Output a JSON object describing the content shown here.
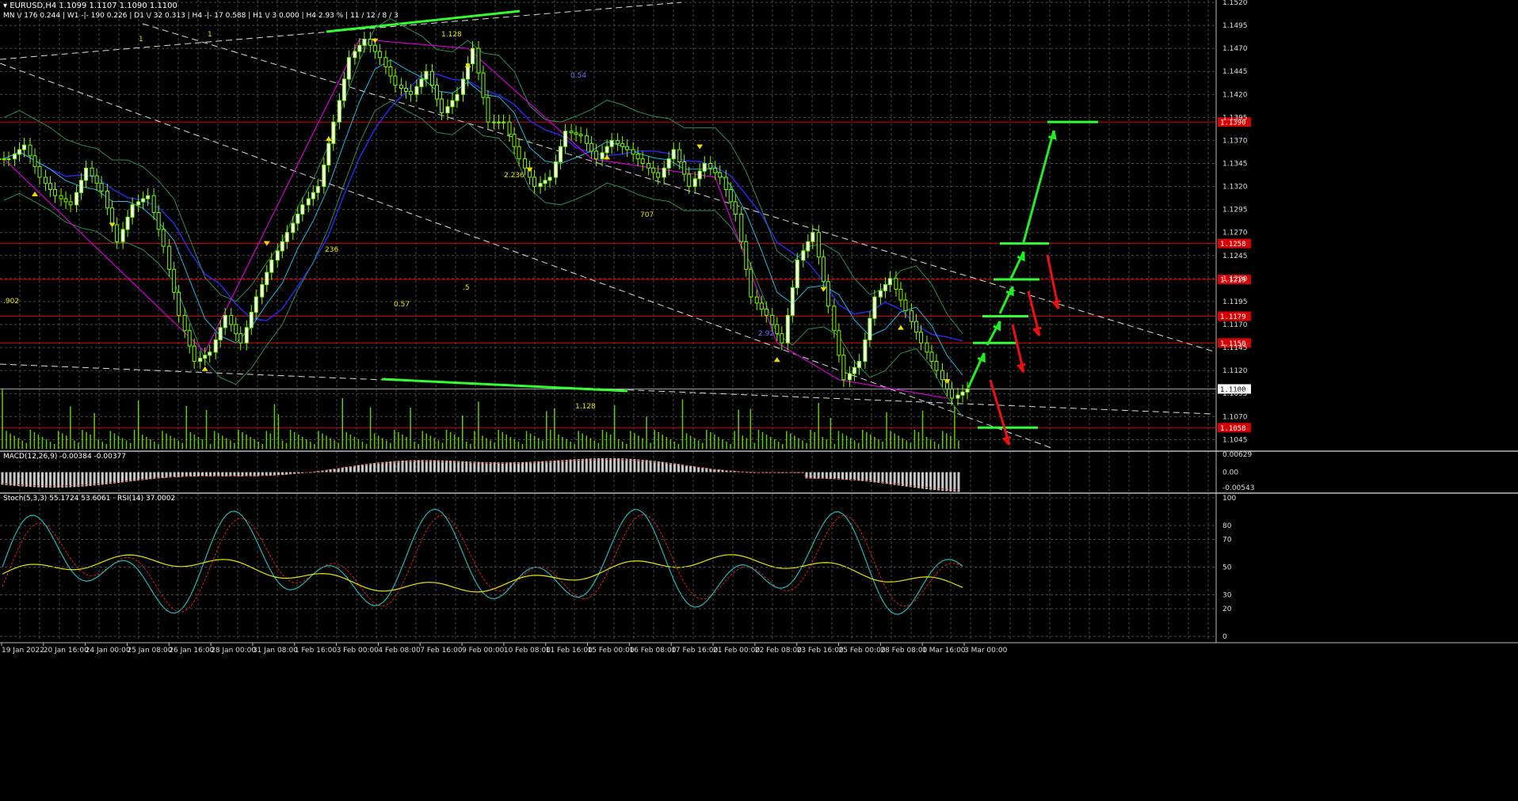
{
  "header": {
    "symbol_line": "▾ EURUSD,H4  1.1099 1.1107 1.1090 1.1100",
    "mtf_line": "MN \\/ 176   0.244  |  W1 -|- 190   0.226  |  D1 \\/ 32   0.313  |  H4 -|- 17   0.588  |  H1 \\/ 3   0.000  |  H4  2.93 %  |  11 / 12 / 8 / 3"
  },
  "colors": {
    "background": "#000000",
    "grid": "#4a4a4a",
    "candle": "#7CFC00",
    "support_resistance": "#d40000",
    "arrow_up": "#22ee22",
    "arrow_down": "#ee1111",
    "zigzag": "#cc00cc",
    "ma_blue": "#2a2ae0",
    "ma_cyan": "#28b4d8",
    "bollinger": "#2e8b57",
    "fractal": "#f2d600",
    "macd_hist": "#c8c8c8",
    "macd_signal": "#cc2222",
    "stoch_main": "#28b4b4",
    "stoch_signal": "#cc2222",
    "rsi": "#e6e600"
  },
  "chart_data": [
    {
      "type": "candlestick",
      "symbol": "EURUSD",
      "timeframe": "H4",
      "ohlc_last": {
        "open": 1.1099,
        "high": 1.1107,
        "low": 1.109,
        "close": 1.11
      },
      "ylim": [
        1.1035,
        1.152
      ],
      "y_ticks": [
        "1.1520",
        "1.1495",
        "1.1470",
        "1.1445",
        "1.1420",
        "1.1395",
        "1.1370",
        "1.1345",
        "1.1320",
        "1.1295",
        "1.1270",
        "1.1245",
        "1.1220",
        "1.1195",
        "1.1170",
        "1.1145",
        "1.1120",
        "1.1095",
        "1.1070",
        "1.1045"
      ],
      "x_ticks": [
        "19 Jan 2022",
        "20 Jan 16:00",
        "24 Jan 00:00",
        "25 Jan 08:00",
        "26 Jan 16:00",
        "28 Jan 00:00",
        "31 Jan 08:00",
        "1 Feb 16:00",
        "3 Feb 00:00",
        "4 Feb 08:00",
        "7 Feb 16:00",
        "9 Feb 00:00",
        "10 Feb 08:00",
        "11 Feb 16:00",
        "15 Feb 00:00",
        "16 Feb 08:00",
        "17 Feb 16:00",
        "21 Feb 00:00",
        "22 Feb 08:00",
        "23 Feb 16:00",
        "25 Feb 00:00",
        "28 Feb 08:00",
        "1 Mar 16:00",
        "3 Mar 00:00"
      ],
      "close_path": [
        1.135,
        1.1365,
        1.133,
        1.131,
        1.13,
        1.134,
        1.1315,
        1.126,
        1.13,
        1.131,
        1.1255,
        1.118,
        1.113,
        1.114,
        1.118,
        1.115,
        1.12,
        1.124,
        1.127,
        1.13,
        1.132,
        1.139,
        1.146,
        1.148,
        1.146,
        1.143,
        1.142,
        1.1445,
        1.14,
        1.142,
        1.147,
        1.139,
        1.139,
        1.135,
        1.132,
        1.133,
        1.138,
        1.1375,
        1.135,
        1.137,
        1.136,
        1.1345,
        1.133,
        1.136,
        1.132,
        1.1345,
        1.133,
        1.129,
        1.12,
        1.118,
        1.115,
        1.124,
        1.127,
        1.119,
        1.111,
        1.113,
        1.12,
        1.122,
        1.1185,
        1.115,
        1.112,
        1.109,
        1.11
      ],
      "price_badges": [
        {
          "label": "1.1390",
          "value": 1.139
        },
        {
          "label": "1.1258",
          "value": 1.1258
        },
        {
          "label": "1.1219",
          "value": 1.1219
        },
        {
          "label": "1.1179",
          "value": 1.1179
        },
        {
          "label": "1.1150",
          "value": 1.115
        },
        {
          "label": "1.1100",
          "value": 1.11
        },
        {
          "label": "1.1058",
          "value": 1.1058
        }
      ],
      "annotations": [
        "1.128",
        "1.128",
        "0.54",
        "2.236",
        "236",
        "707",
        ".5",
        "0.57",
        "2.92",
        ".902",
        "1",
        "1"
      ]
    },
    {
      "type": "line",
      "title": "MACD(12,26,9) -0.00384 -0.00377",
      "y_ticks": [
        "0.00629",
        "0.00",
        "-0.00543"
      ],
      "ylim": [
        -0.00543,
        0.00629
      ]
    },
    {
      "type": "line",
      "title": "Stoch(5,3,3) 55.1724 53.6061 · RSI(14) 37.0002",
      "y_ticks": [
        "100",
        "80",
        "70",
        "50",
        "30",
        "20",
        "0"
      ],
      "ylim": [
        0,
        100
      ]
    }
  ]
}
